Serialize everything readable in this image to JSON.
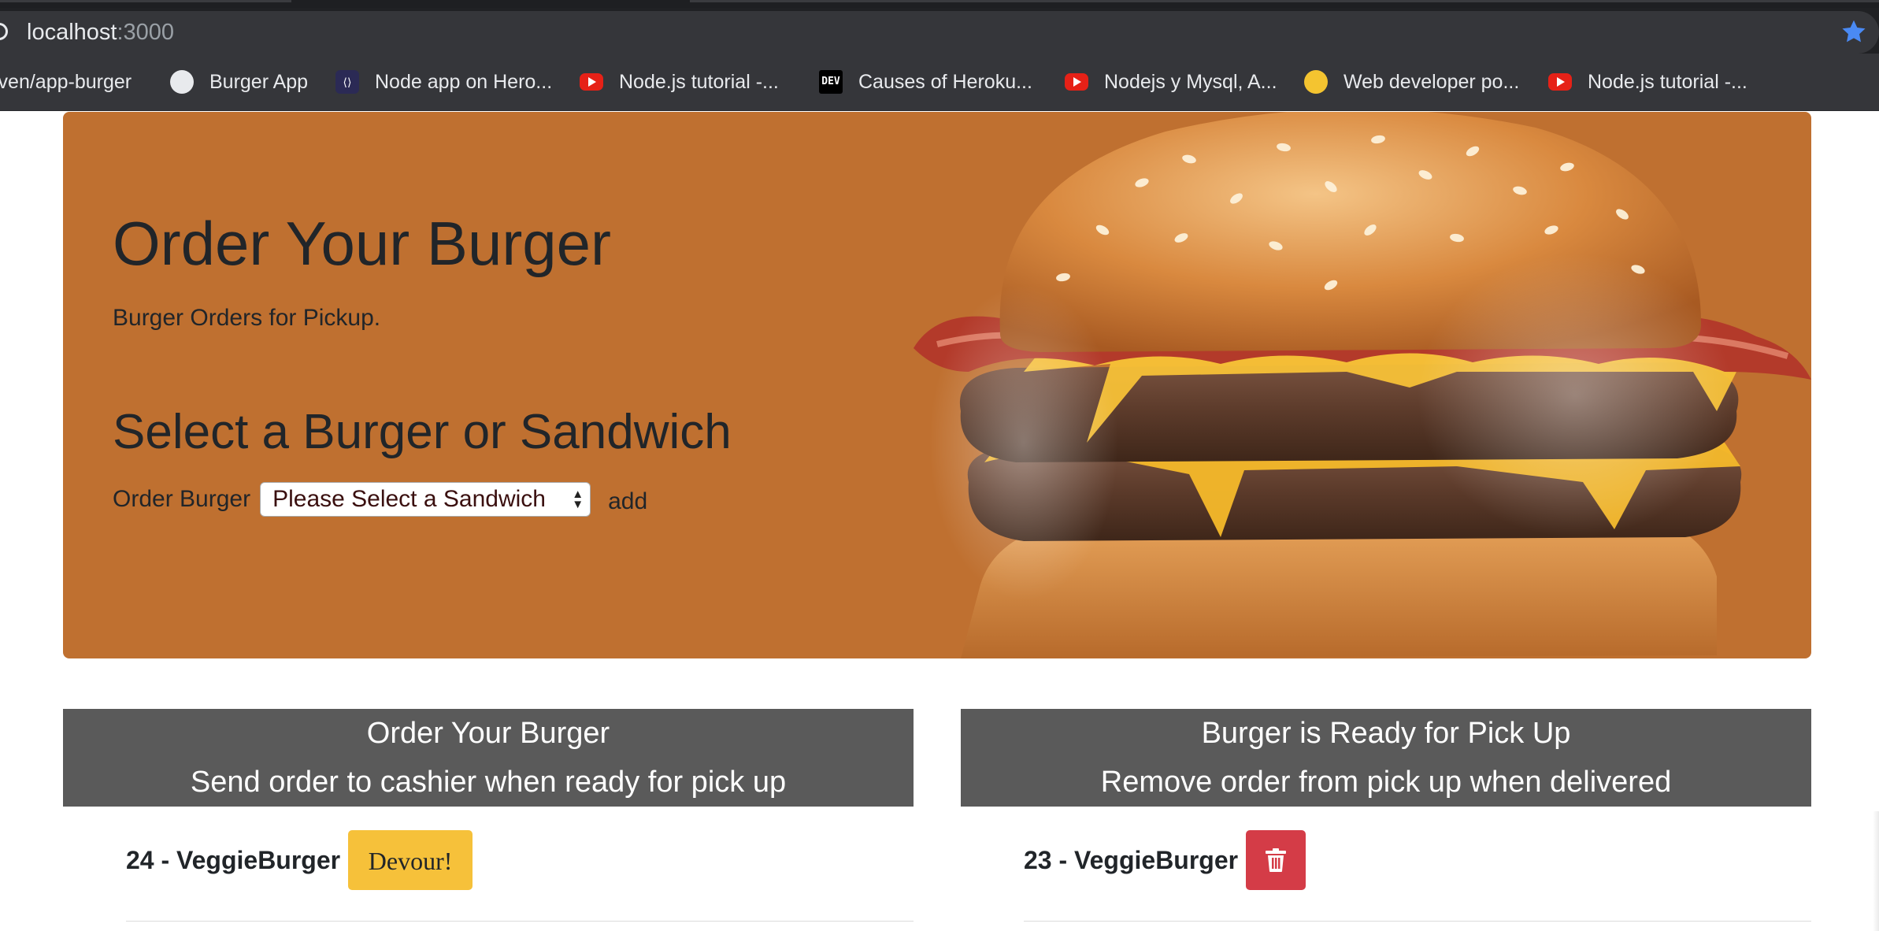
{
  "browser": {
    "url_host": "localhost",
    "url_port": ":3000",
    "bookmarks": [
      {
        "label": "iven/app-burger",
        "icon": "none"
      },
      {
        "label": "Burger App",
        "icon": "globe-icon"
      },
      {
        "label": "Node app on Hero...",
        "icon": "heroku-icon"
      },
      {
        "label": "Node.js tutorial -...",
        "icon": "youtube-icon"
      },
      {
        "label": "Causes of Heroku...",
        "icon": "dev-icon"
      },
      {
        "label": "Nodejs y Mysql, A...",
        "icon": "youtube-icon"
      },
      {
        "label": "Web developer po...",
        "icon": "lightbulb-icon"
      },
      {
        "label": "Node.js tutorial -...",
        "icon": "youtube-icon"
      }
    ]
  },
  "hero": {
    "title": "Order Your Burger",
    "subtitle": "Burger Orders for Pickup.",
    "select_heading": "Select a Burger or Sandwich",
    "order_label": "Order Burger",
    "select_value": "Please Select a Sandwich",
    "add_label": "add"
  },
  "left_panel": {
    "heading_line1": "Order Your Burger",
    "heading_line2": "Send order to cashier when ready for pick up",
    "orders": [
      {
        "name": "24 - VeggieBurger",
        "action": "Devour!"
      }
    ]
  },
  "right_panel": {
    "heading_line1": "Burger is Ready for Pick Up",
    "heading_line2": "Remove order from pick up when delivered",
    "orders": [
      {
        "name": "23 - VeggieBurger",
        "action_icon": "trash-icon"
      }
    ]
  },
  "colors": {
    "jumbotron": "#bf7030",
    "panel_header": "#5a5a5a",
    "devour_button": "#f6c13a",
    "delete_button": "#d43c47"
  }
}
